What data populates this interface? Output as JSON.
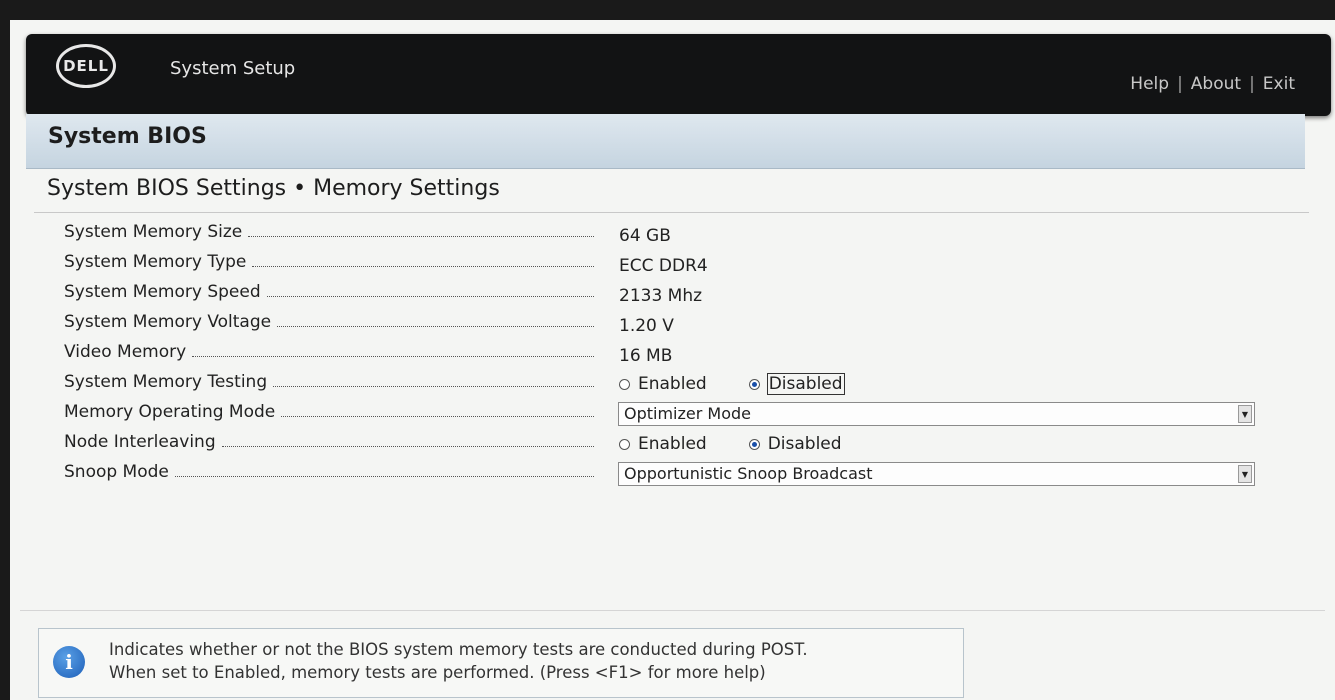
{
  "header": {
    "logo_text": "DELL",
    "app_title": "System Setup",
    "links": [
      "Help",
      "About",
      "Exit"
    ],
    "separator": "|"
  },
  "section": {
    "title": "System BIOS",
    "page_title": "System BIOS Settings • Memory Settings"
  },
  "settings": [
    {
      "label": "System Memory Size",
      "type": "text",
      "value": "64 GB"
    },
    {
      "label": "System Memory Type",
      "type": "text",
      "value": "ECC DDR4"
    },
    {
      "label": "System Memory Speed",
      "type": "text",
      "value": "2133 Mhz"
    },
    {
      "label": "System Memory Voltage",
      "type": "text",
      "value": "1.20 V"
    },
    {
      "label": "Video Memory",
      "type": "text",
      "value": "16 MB"
    },
    {
      "label": "System Memory Testing",
      "type": "radio",
      "options": [
        "Enabled",
        "Disabled"
      ],
      "selected": "Disabled",
      "focused": true
    },
    {
      "label": "Memory Operating Mode",
      "type": "select",
      "value": "Optimizer Mode"
    },
    {
      "label": "Node Interleaving",
      "type": "radio",
      "options": [
        "Enabled",
        "Disabled"
      ],
      "selected": "Disabled",
      "focused": false
    },
    {
      "label": "Snoop Mode",
      "type": "select",
      "value": "Opportunistic Snoop Broadcast"
    }
  ],
  "help": {
    "icon": "info-icon",
    "line1": "Indicates whether or not the BIOS system memory tests are conducted during POST.",
    "line2": "When set to Enabled, memory tests are performed. (Press <F1> for more help)"
  }
}
